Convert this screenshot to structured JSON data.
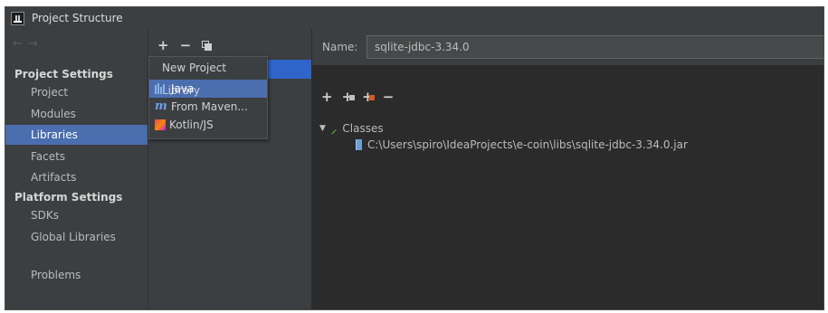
{
  "window": {
    "title": "Project Structure",
    "app_icon": "intellij-icon"
  },
  "sidebar": {
    "nav_back": "←",
    "nav_forward": "→",
    "project_settings_title": "Project Settings",
    "project_items": [
      {
        "label": "Project",
        "selected": false
      },
      {
        "label": "Modules",
        "selected": false
      },
      {
        "label": "Libraries",
        "selected": true
      },
      {
        "label": "Facets",
        "selected": false
      },
      {
        "label": "Artifacts",
        "selected": false
      }
    ],
    "platform_settings_title": "Platform Settings",
    "platform_items": [
      {
        "label": "SDKs"
      },
      {
        "label": "Global Libraries"
      }
    ],
    "problems_label": "Problems"
  },
  "middle_toolbar": {
    "add": "+",
    "remove": "−"
  },
  "popup": {
    "header": "New Project Library",
    "items": [
      {
        "label": "Java",
        "icon": "java-library-icon",
        "selected": true
      },
      {
        "label": "From Maven...",
        "icon": "maven-icon",
        "selected": false
      },
      {
        "label": "Kotlin/JS",
        "icon": "kotlin-icon",
        "selected": false
      }
    ]
  },
  "detail": {
    "name_label": "Name:",
    "name_value": "sqlite-jdbc-3.34.0",
    "toolbar": {
      "add": "+",
      "add_class": "+",
      "add_jar": "+",
      "remove": "−"
    },
    "tree": {
      "root_label": "Classes",
      "root_icon": "hammer-icon",
      "child_path": "C:\\Users\\spiro\\IdeaProjects\\e-coin\\libs\\sqlite-jdbc-3.34.0.jar",
      "child_icon": "jar-icon"
    }
  },
  "colors": {
    "selection": "#4b6eaf",
    "panel_bg": "#3c3f41",
    "editor_bg": "#2b2b2b",
    "text": "#bbbbbb"
  }
}
